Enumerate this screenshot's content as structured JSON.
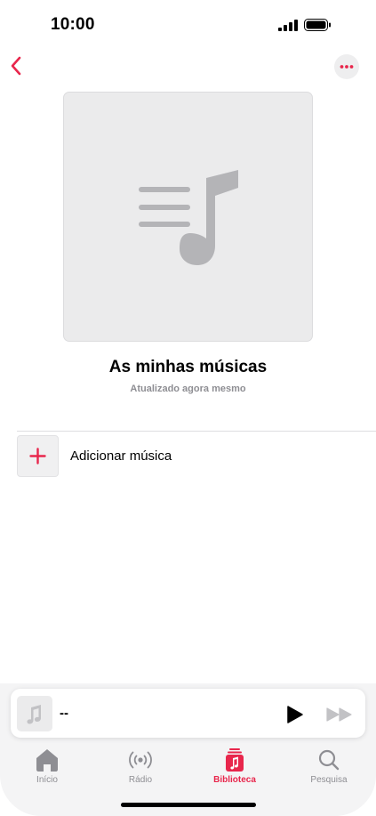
{
  "status_bar": {
    "time": "10:00"
  },
  "playlist": {
    "title": "As minhas músicas",
    "subtitle": "Atualizado agora mesmo"
  },
  "actions": {
    "add_music_label": "Adicionar música"
  },
  "mini_player": {
    "track_title": "--"
  },
  "tab_bar": {
    "items": [
      {
        "label": "Início",
        "icon": "house-icon"
      },
      {
        "label": "Rádio",
        "icon": "radio-waves-icon"
      },
      {
        "label": "Biblioteca",
        "icon": "library-icon",
        "active": true
      },
      {
        "label": "Pesquisa",
        "icon": "magnifier-icon"
      }
    ]
  },
  "colors": {
    "accent": "#e8264c",
    "inactive": "#8e8e93",
    "artwork_bg": "#ebebec",
    "artwork_glyph": "#b4b4b7"
  }
}
